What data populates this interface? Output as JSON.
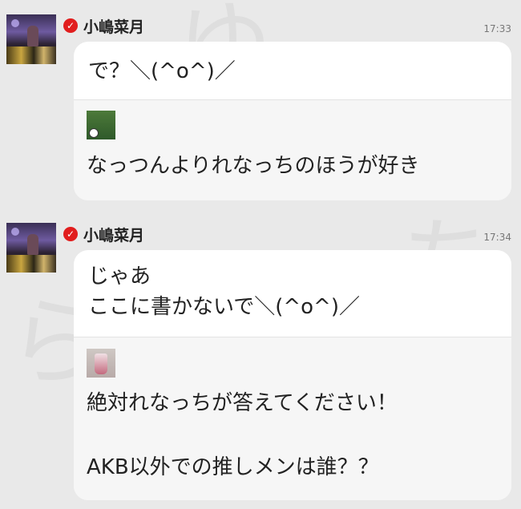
{
  "posts": [
    {
      "author": "小嶋菜月",
      "time": "17:33",
      "message": "で？＼(^o^)／",
      "reply_text": "なっつんよりれなっちのほうが好き"
    },
    {
      "author": "小嶋菜月",
      "time": "17:34",
      "message_lines": [
        "じゃあ",
        "ここに書かないで＼(^o^)／"
      ],
      "reply_lines": [
        "絶対れなっちが答えてください！",
        "",
        "AKB以外での推しメンは誰？？"
      ]
    }
  ],
  "icons": {
    "verified": "check-badge-icon"
  },
  "colors": {
    "background": "#e9e9e9",
    "bubble": "#ffffff",
    "reply_area": "#f6f6f6",
    "verified_badge": "#e11d1d"
  }
}
